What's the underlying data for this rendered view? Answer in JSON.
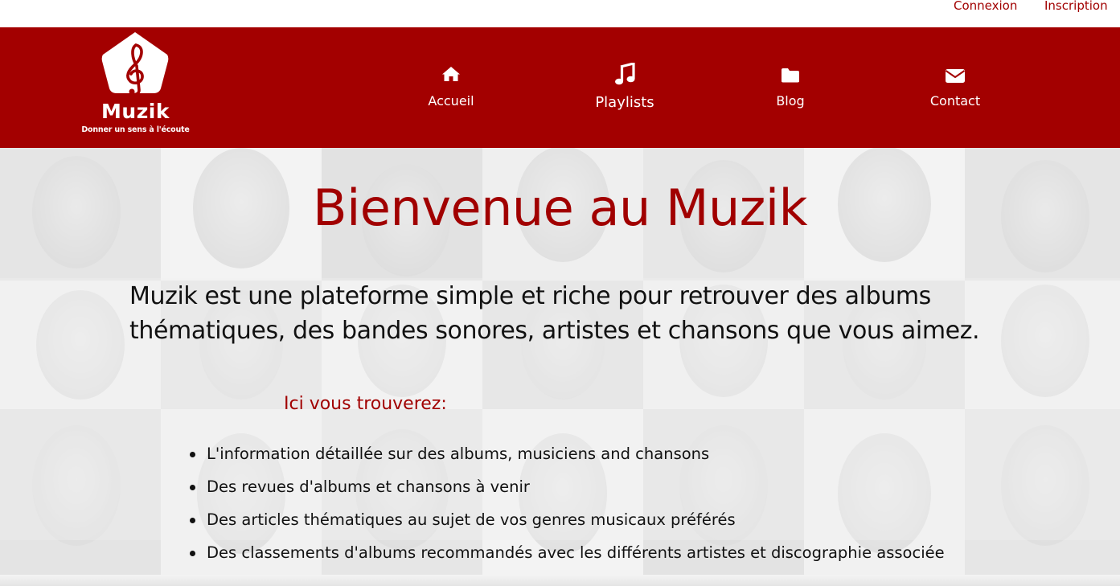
{
  "topbar": {
    "login_label": "Connexion",
    "signup_label": "Inscription"
  },
  "logo": {
    "name": "Muzik",
    "tagline": "Donner un sens à l'écoute",
    "icon": "treble-clef-icon"
  },
  "nav": {
    "items": [
      {
        "label": "Accueil",
        "icon": "home-icon"
      },
      {
        "label": "Playlists",
        "icon": "music-note-icon"
      },
      {
        "label": "Blog",
        "icon": "folder-icon"
      },
      {
        "label": "Contact",
        "icon": "envelope-icon"
      }
    ]
  },
  "hero": {
    "title": "Bienvenue au Muzik",
    "intro": "Muzik est une plateforme simple et riche pour retrouver des albums thématiques, des bandes sonores, artistes et chansons que vous aimez.",
    "subhead": "Ici vous trouverez:",
    "features": [
      "L'information détaillée sur des albums, musiciens and chansons",
      "Des revues d'albums et chansons à venir",
      "Des articles thématiques au sujet de vos genres musicaux préférés",
      "Des classements d'albums recommandés avec les différents artistes et discographie associée"
    ]
  },
  "colors": {
    "brand": "#a30000",
    "brand_text": "#a10000",
    "body_text": "#111111",
    "header_text": "#ffffff"
  }
}
